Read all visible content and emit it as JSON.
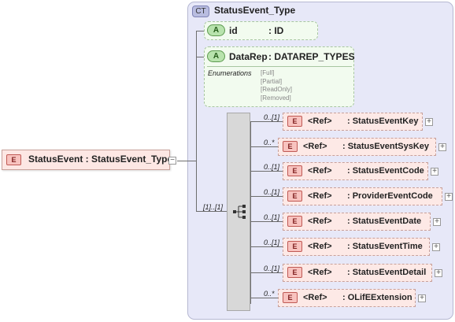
{
  "root": {
    "badge": "E",
    "label": "StatusEvent : StatusEvent_Type"
  },
  "complex_type": {
    "badge": "CT",
    "name": "StatusEvent_Type"
  },
  "attributes": [
    {
      "badge": "A",
      "name": "id",
      "type": ": ID"
    },
    {
      "badge": "A",
      "name": "DataRep",
      "type": ": DATAREP_TYPES",
      "enumerations_label": "Enumerations",
      "enumerations": [
        "[Full]",
        "[Partial]",
        "[ReadOnly]",
        "[Removed]"
      ]
    }
  ],
  "sequence": {
    "cardinality": "[1]..[1]"
  },
  "children": [
    {
      "card": "0..[1]",
      "badge": "E",
      "ref": "<Ref>",
      "name": ": StatusEventKey"
    },
    {
      "card": "0..*",
      "badge": "E",
      "ref": "<Ref>",
      "name": ": StatusEventSysKey"
    },
    {
      "card": "0..[1]",
      "badge": "E",
      "ref": "<Ref>",
      "name": ": StatusEventCode"
    },
    {
      "card": "0..[1]",
      "badge": "E",
      "ref": "<Ref>",
      "name": ": ProviderEventCode"
    },
    {
      "card": "0..[1]",
      "badge": "E",
      "ref": "<Ref>",
      "name": ": StatusEventDate"
    },
    {
      "card": "0..[1]",
      "badge": "E",
      "ref": "<Ref>",
      "name": ": StatusEventTime"
    },
    {
      "card": "0..[1]",
      "badge": "E",
      "ref": "<Ref>",
      "name": ": StatusEventDetail"
    },
    {
      "card": "0..*",
      "badge": "E",
      "ref": "<Ref>",
      "name": ": OLifEExtension"
    }
  ],
  "expander_symbol": "+",
  "collapse_symbol": "−"
}
